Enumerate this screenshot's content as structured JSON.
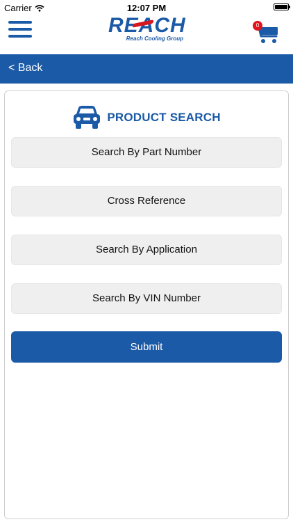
{
  "status_bar": {
    "carrier": "Carrier",
    "time": "12:07 PM"
  },
  "header": {
    "logo_text": "REACH",
    "logo_subtext": "Reach Cooling Group",
    "cart_count": "0",
    "brand_color": "#1b5aa6"
  },
  "back_bar": {
    "label": "< Back"
  },
  "product_search": {
    "title": "PRODUCT SEARCH",
    "options": [
      "Search By Part Number",
      "Cross Reference",
      "Search By Application",
      "Search By VIN Number"
    ],
    "submit_label": "Submit"
  }
}
